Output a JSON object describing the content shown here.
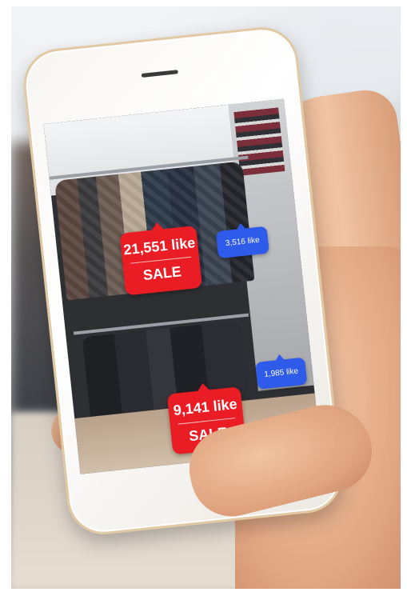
{
  "ar_tags": {
    "item_1": {
      "likes": "21,551 like",
      "sale": "SALE"
    },
    "item_2": {
      "likes": "3,516 like"
    },
    "item_3": {
      "likes": "9,141 like",
      "sale": "SALE"
    },
    "item_4": {
      "likes": "1,985 like"
    }
  },
  "colors": {
    "sale_badge": "#ea1c24",
    "like_badge": "#2f5bea"
  }
}
